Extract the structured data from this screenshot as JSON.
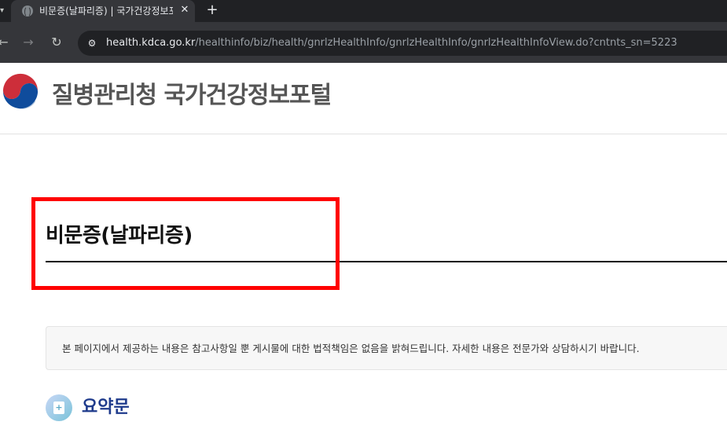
{
  "browser": {
    "tab": {
      "title": "비문증(날파리증) | 국가건강정보포털",
      "close_glyph": "✕"
    },
    "new_tab_glyph": "+",
    "tab_menu_glyph": "▾",
    "nav": {
      "back_glyph": "←",
      "forward_glyph": "→",
      "reload_glyph": "↻"
    },
    "site_info_glyph": "⚙",
    "url": {
      "host": "health.kdca.go.kr",
      "path": "/healthinfo/biz/health/gnrlzHealthInfo/gnrlzHealthInfo/gnrlzHealthInfoView.do?cntnts_sn=5223"
    }
  },
  "site": {
    "title": "질병관리청 국가건강정보포털",
    "logo_icon": "taegeuk-logo-icon"
  },
  "page": {
    "title": "비문증(날파리증)",
    "notice": "본 페이지에서 제공하는 내용은 참고사항일 뿐 게시물에 대한 법적책임은 없음을 밝혀드립니다. 자세한 내용은 전문가와 상담하시기 바랍니다.",
    "section": {
      "title": "요약문",
      "icon": "document-plus-icon",
      "icon_glyph": "+"
    }
  },
  "colors": {
    "highlight": "#ff0000",
    "section_title": "#1f3b8c",
    "logo_red": "#cd2e3a",
    "logo_blue": "#0f4c9c"
  }
}
